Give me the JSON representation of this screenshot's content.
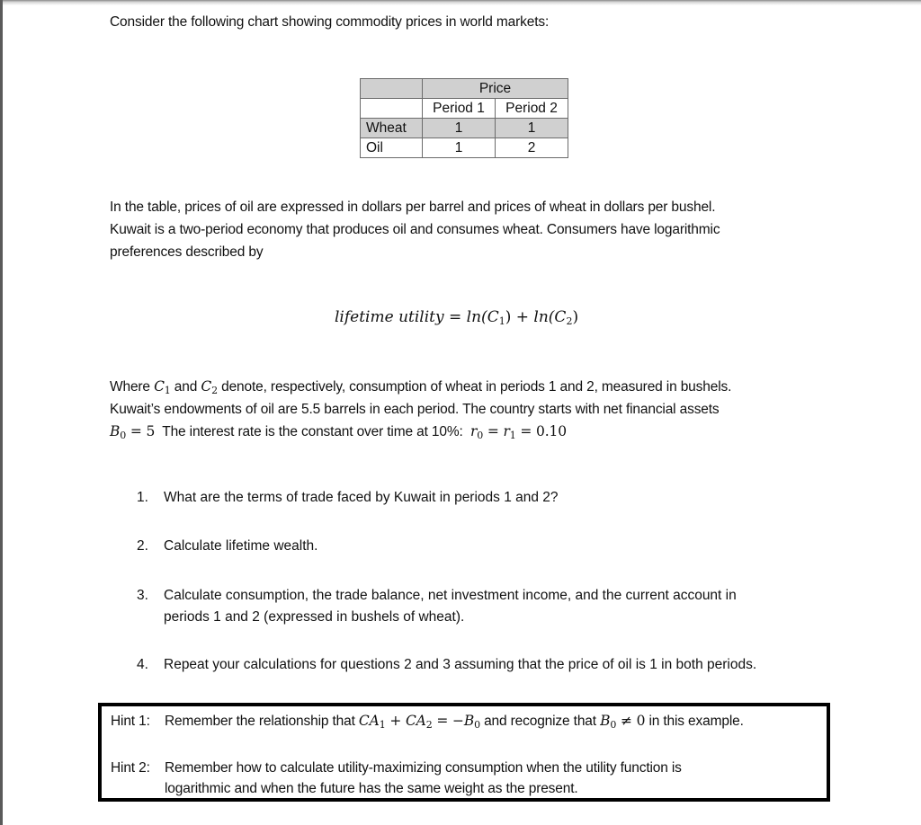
{
  "intro": "Consider the following chart showing commodity prices in world markets:",
  "price_table": {
    "group_header": "Price",
    "columns": [
      "Period 1",
      "Period 2"
    ],
    "rows": [
      {
        "label": "Wheat",
        "values": [
          "1",
          "1"
        ]
      },
      {
        "label": "Oil",
        "values": [
          "1",
          "2"
        ]
      }
    ]
  },
  "paragraph1": {
    "lines": [
      "In the table, prices of oil are expressed in dollars per barrel and prices of wheat in dollars per bushel.",
      "Kuwait is a two-period economy that produces oil and consumes wheat.  Consumers have logarithmic",
      "preferences described by"
    ]
  },
  "formula": {
    "lhs": "lifetime utility",
    "equals": " = ",
    "term1": "ln(C",
    "term1_sub": "1",
    "term1_close": ")",
    "plus": " + ",
    "term2": "ln(C",
    "term2_sub": "2",
    "term2_close": ")"
  },
  "paragraph2": {
    "line1_a": "Where ",
    "c1": "C",
    "c1_sub": "1",
    "line1_b": " and ",
    "c2": "C",
    "c2_sub": "2",
    "line1_c": " denote, respectively, consumption of wheat in periods 1 and 2, measured in bushels.",
    "line2": "Kuwait’s endowments of oil are 5.5 barrels in each period.  The country starts with net financial assets",
    "b0": "B",
    "b0_sub": "0",
    "b0_value": " = 5",
    "line3_b": "  The interest rate is the constant over time at 10%:  ",
    "r0": "r",
    "r0_sub": "0",
    "r_eq": " = ",
    "r1": "r",
    "r1_sub": "1",
    "r_value": " = 0.10"
  },
  "questions": [
    {
      "num": "1.",
      "lines": [
        "What are the terms of trade faced by Kuwait in periods 1 and 2?"
      ]
    },
    {
      "num": "2.",
      "lines": [
        "Calculate lifetime wealth."
      ]
    },
    {
      "num": "3.",
      "lines": [
        "Calculate consumption, the trade balance, net investment income, and the current account in",
        "periods 1 and 2 (expressed in bushels of wheat)."
      ]
    },
    {
      "num": "4.",
      "lines": [
        "Repeat your calculations for questions 2 and 3 assuming that the price of oil is 1 in both periods."
      ]
    }
  ],
  "hints": {
    "hint1": {
      "label": "Hint 1:",
      "text_a": "Remember the relationship that ",
      "ca1": "CA",
      "ca1_sub": "1",
      "plus": " + ",
      "ca2": "CA",
      "ca2_sub": "2",
      "eq": " = −",
      "b0": "B",
      "b0_sub": "0",
      "text_b": " and recognize that ",
      "b0b": "B",
      "b0b_sub": "0",
      "neq": " ≠ 0",
      "text_c": " in this example."
    },
    "hint2": {
      "label": "Hint 2:",
      "lines": [
        "Remember how to calculate utility-maximizing consumption when the utility function is",
        "logarithmic and when the future has the same weight as the present."
      ]
    }
  }
}
